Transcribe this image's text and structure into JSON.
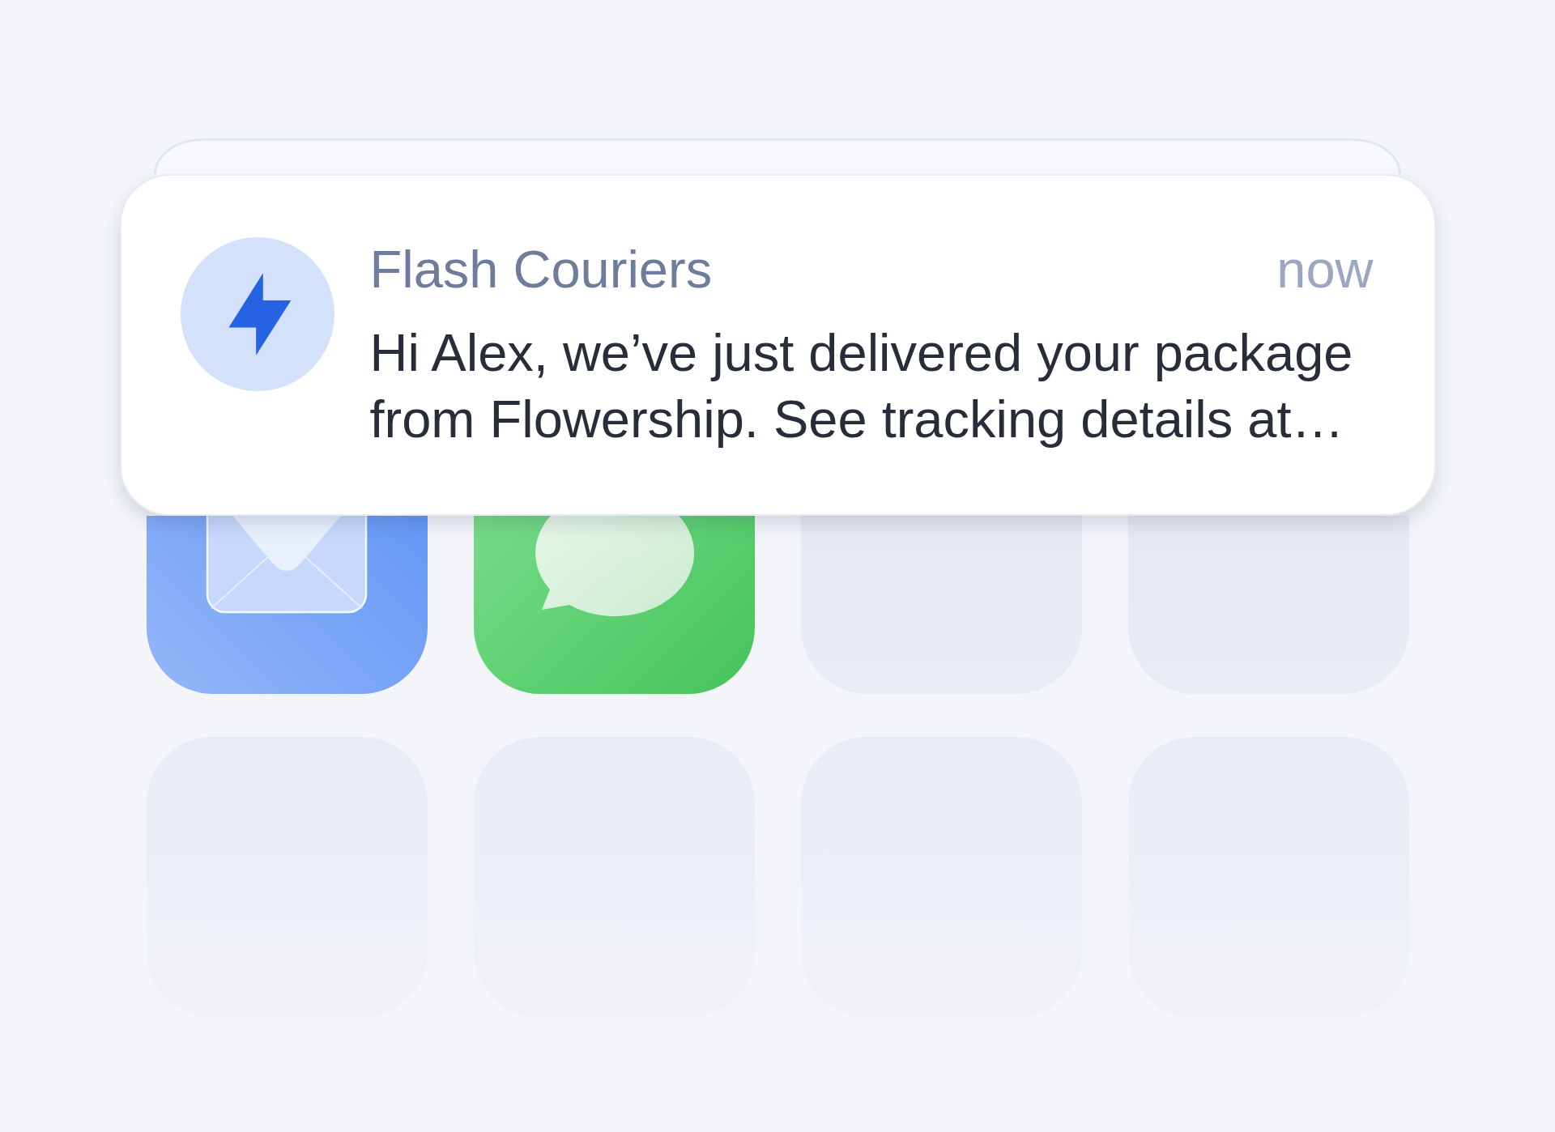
{
  "notification": {
    "stacked": true,
    "app_name": "Flash Couriers",
    "time": "now",
    "message": "Hi Alex, we’ve just delivered your package from Flowership. See tracking details at…"
  },
  "home_screen": {
    "apps": [
      {
        "kind": "mail"
      },
      {
        "kind": "messages"
      },
      {
        "kind": "blank"
      },
      {
        "kind": "blank"
      },
      {
        "kind": "blank"
      },
      {
        "kind": "blank"
      },
      {
        "kind": "blank"
      },
      {
        "kind": "blank"
      }
    ]
  }
}
